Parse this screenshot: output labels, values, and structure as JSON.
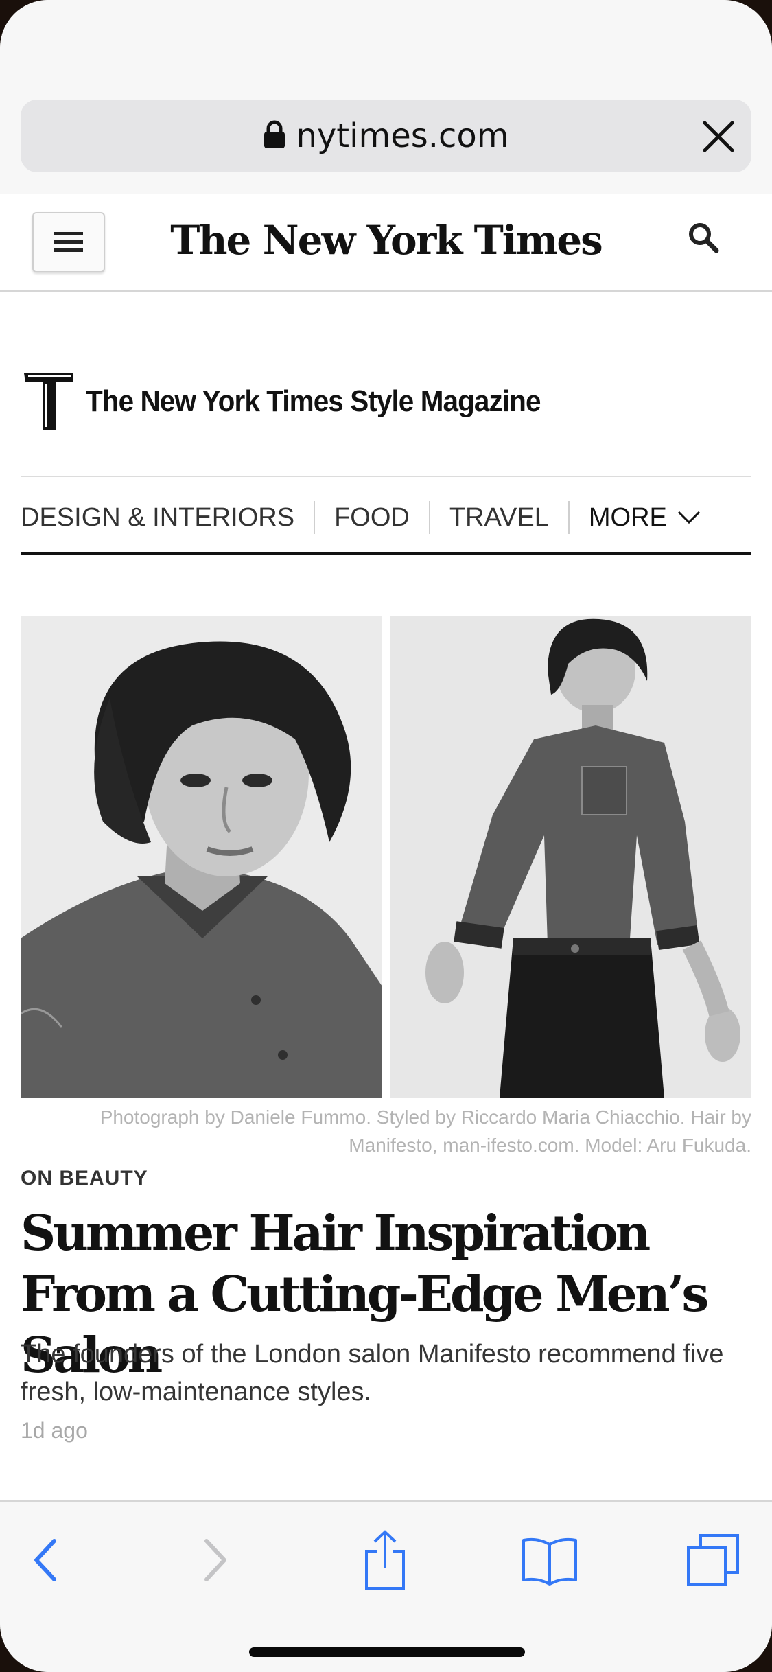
{
  "browser": {
    "url": "nytimes.com",
    "accent_color": "#3478f6"
  },
  "header": {
    "masthead": "The New York Times"
  },
  "tmag": {
    "title": "The New York Times Style Magazine"
  },
  "nav": {
    "items": [
      "DESIGN & INTERIORS",
      "FOOD",
      "TRAVEL"
    ],
    "more_label": "MORE"
  },
  "article": {
    "photo_caption": "Photograph by Daniele Fummo. Styled by Riccardo Maria Chiacchio. Hair by Manifesto, man-ifesto.com. Model: Aru Fukuda.",
    "kicker": "ON BEAUTY",
    "headline": "Summer Hair Inspiration From a Cutting-Edge Men’s Salon",
    "summary": "The founders of the London salon Manifesto recommend five fresh, low-maintenance styles.",
    "timestamp": "1d ago"
  },
  "toolbar": {
    "icons": [
      "back-icon",
      "forward-icon",
      "share-icon",
      "bookmarks-icon",
      "tabs-icon"
    ]
  }
}
